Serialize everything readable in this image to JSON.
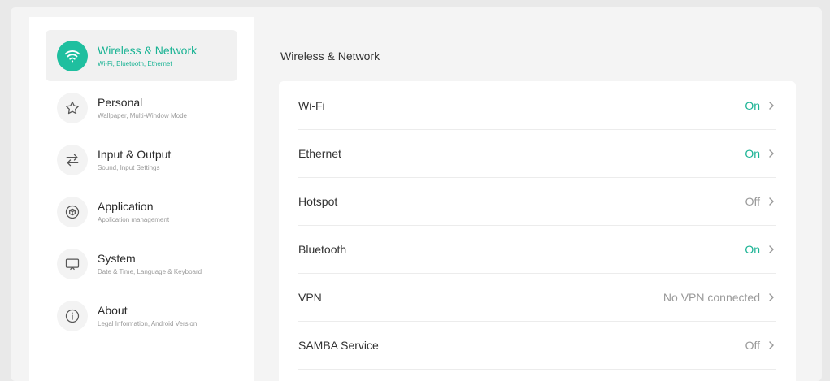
{
  "sidebar": {
    "items": [
      {
        "title": "Wireless & Network",
        "subtitle": "Wi-Fi, Bluetooth, Ethernet",
        "icon": "wifi-icon",
        "active": true
      },
      {
        "title": "Personal",
        "subtitle": "Wallpaper, Multi-Window Mode",
        "icon": "star-icon",
        "active": false
      },
      {
        "title": "Input & Output",
        "subtitle": "Sound, Input Settings",
        "icon": "arrows-exchange-icon",
        "active": false
      },
      {
        "title": "Application",
        "subtitle": "Application management",
        "icon": "cube-icon",
        "active": false
      },
      {
        "title": "System",
        "subtitle": "Date & Time, Language & Keyboard",
        "icon": "monitor-icon",
        "active": false
      },
      {
        "title": "About",
        "subtitle": "Legal Information, Android Version",
        "icon": "info-icon",
        "active": false
      }
    ]
  },
  "main": {
    "title": "Wireless & Network",
    "rows": [
      {
        "label": "Wi-Fi",
        "value": "On",
        "status": "on"
      },
      {
        "label": "Ethernet",
        "value": "On",
        "status": "on"
      },
      {
        "label": "Hotspot",
        "value": "Off",
        "status": "off"
      },
      {
        "label": "Bluetooth",
        "value": "On",
        "status": "on"
      },
      {
        "label": "VPN",
        "value": "No VPN connected",
        "status": "off"
      },
      {
        "label": "SAMBA Service",
        "value": "Off",
        "status": "off"
      }
    ]
  },
  "colors": {
    "accent": "#1ab394",
    "active_icon_bg": "#1fbf9f"
  }
}
